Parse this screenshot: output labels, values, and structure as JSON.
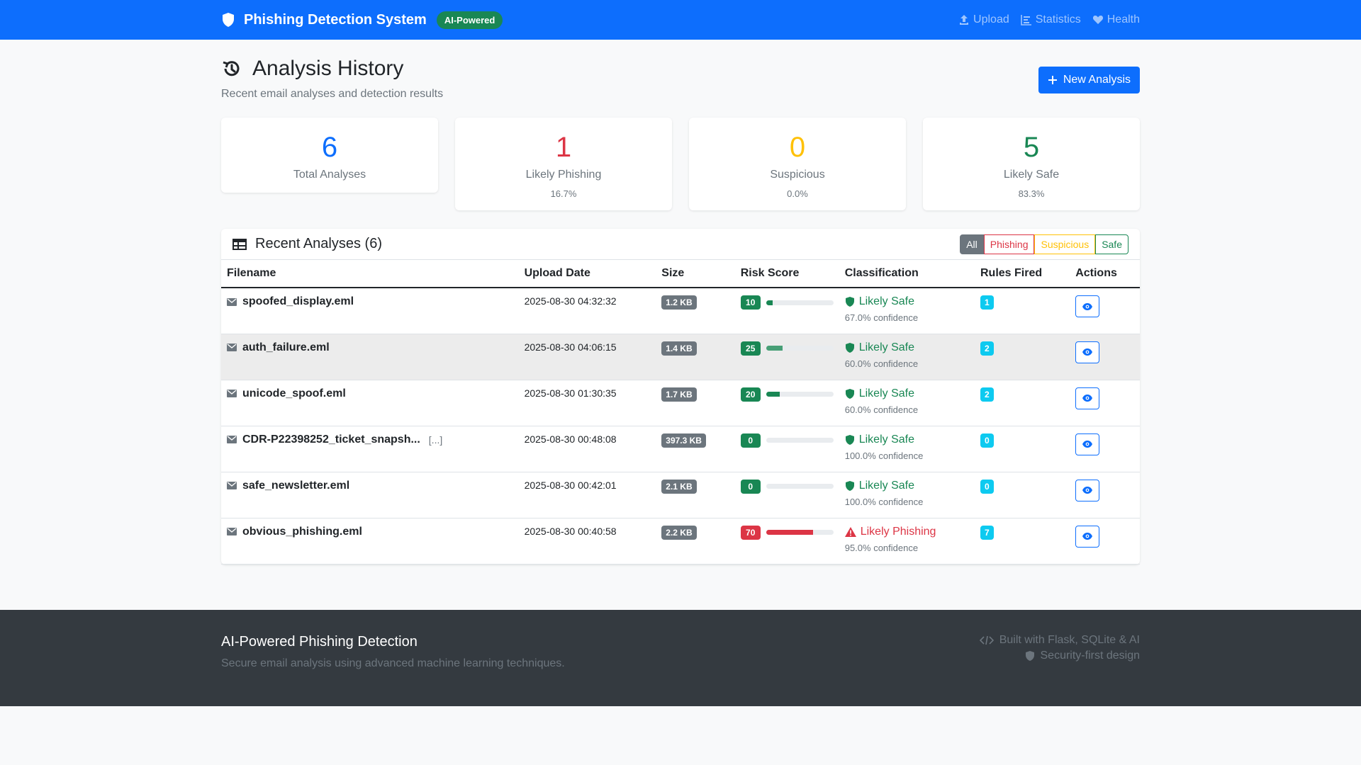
{
  "navbar": {
    "brand": "Phishing Detection System",
    "badge": "AI-Powered",
    "links": [
      {
        "label": "Upload",
        "icon": "upload-icon"
      },
      {
        "label": "Statistics",
        "icon": "chart-icon"
      },
      {
        "label": "Health",
        "icon": "heart-icon"
      }
    ]
  },
  "header": {
    "title": "Analysis History",
    "subtitle": "Recent email analyses and detection results",
    "new_button": "New Analysis"
  },
  "stats": [
    {
      "value": "6",
      "label": "Total Analyses",
      "pct": "",
      "color": "#0d6efd"
    },
    {
      "value": "1",
      "label": "Likely Phishing",
      "pct": "16.7%",
      "color": "#dc3545"
    },
    {
      "value": "0",
      "label": "Suspicious",
      "pct": "0.0%",
      "color": "#ffc107"
    },
    {
      "value": "5",
      "label": "Likely Safe",
      "pct": "83.3%",
      "color": "#198754"
    }
  ],
  "table": {
    "title": "Recent Analyses (6)",
    "filters": [
      "All",
      "Phishing",
      "Suspicious",
      "Safe"
    ],
    "columns": [
      "Filename",
      "Upload Date",
      "Size",
      "Risk Score",
      "Classification",
      "Rules Fired",
      "Actions"
    ],
    "rows": [
      {
        "filename": "spoofed_display.eml",
        "trunc": "",
        "date": "2025-08-30 04:32:32",
        "size": "1.2 KB",
        "risk": "10",
        "risk_fraction": 0.1,
        "classification": "Likely Safe",
        "confidence": "67.0% confidence",
        "rules": "1",
        "kind": "safe"
      },
      {
        "filename": "auth_failure.eml",
        "trunc": "",
        "date": "2025-08-30 04:06:15",
        "size": "1.4 KB",
        "risk": "25",
        "risk_fraction": 0.25,
        "classification": "Likely Safe",
        "confidence": "60.0% confidence",
        "rules": "2",
        "kind": "safe"
      },
      {
        "filename": "unicode_spoof.eml",
        "trunc": "",
        "date": "2025-08-30 01:30:35",
        "size": "1.7 KB",
        "risk": "20",
        "risk_fraction": 0.2,
        "classification": "Likely Safe",
        "confidence": "60.0% confidence",
        "rules": "2",
        "kind": "safe"
      },
      {
        "filename": "CDR-P22398252_ticket_snapsh...",
        "trunc": "[...]",
        "date": "2025-08-30 00:48:08",
        "size": "397.3 KB",
        "risk": "0",
        "risk_fraction": 0.0,
        "classification": "Likely Safe",
        "confidence": "100.0% confidence",
        "rules": "0",
        "kind": "safe"
      },
      {
        "filename": "safe_newsletter.eml",
        "trunc": "",
        "date": "2025-08-30 00:42:01",
        "size": "2.1 KB",
        "risk": "0",
        "risk_fraction": 0.0,
        "classification": "Likely Safe",
        "confidence": "100.0% confidence",
        "rules": "0",
        "kind": "safe"
      },
      {
        "filename": "obvious_phishing.eml",
        "trunc": "",
        "date": "2025-08-30 00:40:58",
        "size": "2.2 KB",
        "risk": "70",
        "risk_fraction": 0.7,
        "classification": "Likely Phishing",
        "confidence": "95.0% confidence",
        "rules": "7",
        "kind": "phishing"
      }
    ]
  },
  "footer": {
    "title": "AI-Powered Phishing Detection",
    "subtitle": "Secure email analysis using advanced machine learning techniques.",
    "built": "Built with Flask, SQLite & AI",
    "security": "Security-first design"
  }
}
